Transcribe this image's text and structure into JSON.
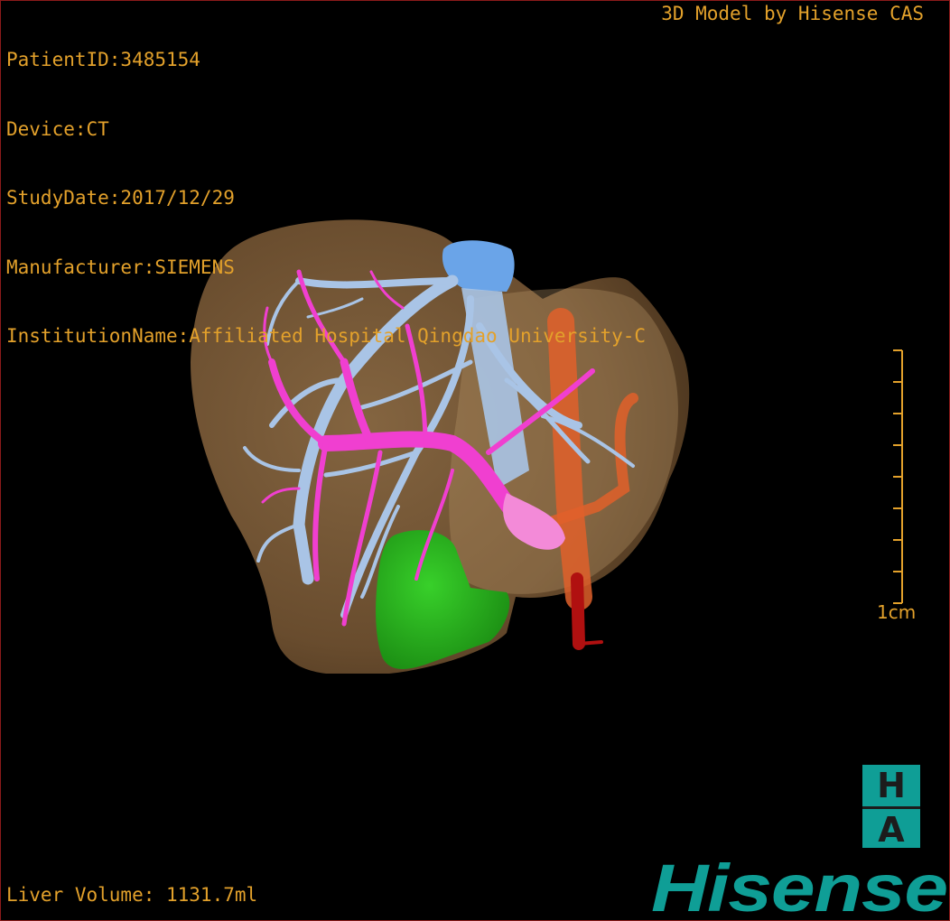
{
  "viewer": {
    "info_lines": [
      "PatientID:3485154",
      "Device:CT",
      "StudyDate:2017/12/29",
      "Manufacturer:SIEMENS",
      "InstitutionName:Affiliated Hospital Qingdao University-C"
    ],
    "credit": "3D Model by Hisense CAS",
    "volume": "Liver Volume: 1131.7ml",
    "scale_label": "1cm"
  },
  "logo": {
    "ha_top": "H",
    "ha_bottom": "A",
    "brand": "Hisense"
  },
  "colors": {
    "overlay_text": "#e3a12b",
    "frame": "#8b1a1a",
    "brand_teal": "#0f9e96",
    "liver": "#7a5a36",
    "hepatic_vein": "#a9c4e6",
    "portal_vein": "#f03fd0",
    "artery": "#e0602a",
    "gallbladder": "#2fb81f",
    "cava_top": "#6aa4e8"
  }
}
